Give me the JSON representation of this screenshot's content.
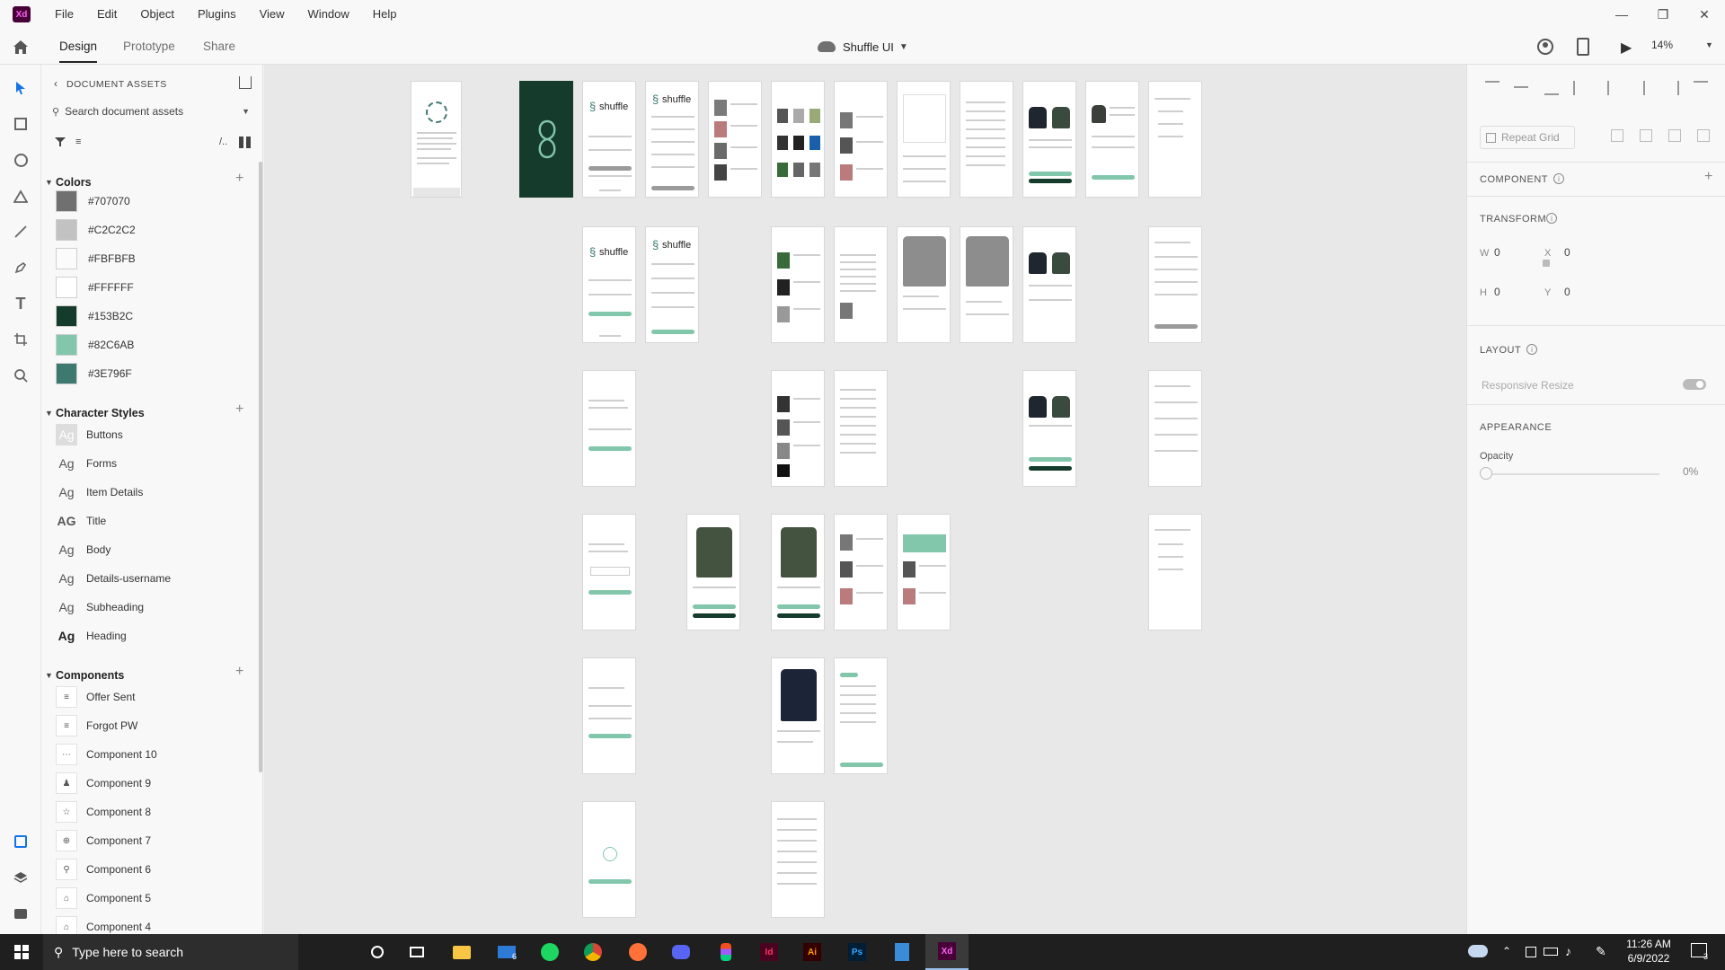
{
  "menubar": {
    "logo": "Xd",
    "items": [
      "File",
      "Edit",
      "Object",
      "Plugins",
      "View",
      "Window",
      "Help"
    ]
  },
  "toolbar": {
    "tabs": [
      "Design",
      "Prototype",
      "Share"
    ],
    "document_title": "Shuffle UI",
    "zoom": "14%"
  },
  "assets": {
    "header": "DOCUMENT ASSETS",
    "search_placeholder": "Search document assets",
    "colors_title": "Colors",
    "colors": [
      "#707070",
      "#C2C2C2",
      "#FBFBFB",
      "#FFFFFF",
      "#153B2C",
      "#82C6AB",
      "#3E796F"
    ],
    "char_title": "Character Styles",
    "char_styles": [
      {
        "glyph": "Ag",
        "name": "Buttons"
      },
      {
        "glyph": "Ag",
        "name": "Forms"
      },
      {
        "glyph": "Ag",
        "name": "Item Details"
      },
      {
        "glyph": "AG",
        "name": "Title"
      },
      {
        "glyph": "Ag",
        "name": "Body"
      },
      {
        "glyph": "Ag",
        "name": "Details-username"
      },
      {
        "glyph": "Ag",
        "name": "Subheading"
      },
      {
        "glyph": "Ag",
        "name": "Heading"
      }
    ],
    "components_title": "Components",
    "components": [
      "Offer Sent",
      "Forgot PW",
      "Component 10",
      "Component 9",
      "Component 8",
      "Component 7",
      "Component 6",
      "Component 5",
      "Component 4"
    ]
  },
  "canvas": {
    "brand_text": "shuffle"
  },
  "props": {
    "repeat_grid": "Repeat Grid",
    "component_title": "COMPONENT",
    "transform_title": "TRANSFORM",
    "w_label": "W",
    "w_value": "0",
    "x_label": "X",
    "x_value": "0",
    "h_label": "H",
    "h_value": "0",
    "y_label": "Y",
    "y_value": "0",
    "layout_title": "LAYOUT",
    "responsive_resize": "Responsive Resize",
    "appearance_title": "APPEARANCE",
    "opacity_label": "Opacity",
    "opacity_value": "0%"
  },
  "taskbar": {
    "search_placeholder": "Type here to search",
    "mail_badge": "6",
    "time": "11:26 AM",
    "date": "6/9/2022",
    "notif_badge": "3"
  },
  "colors": {
    "dark_green": "#153B2C",
    "mint": "#82C6AB",
    "teal": "#3E796F",
    "xd_brand": "#470137"
  }
}
